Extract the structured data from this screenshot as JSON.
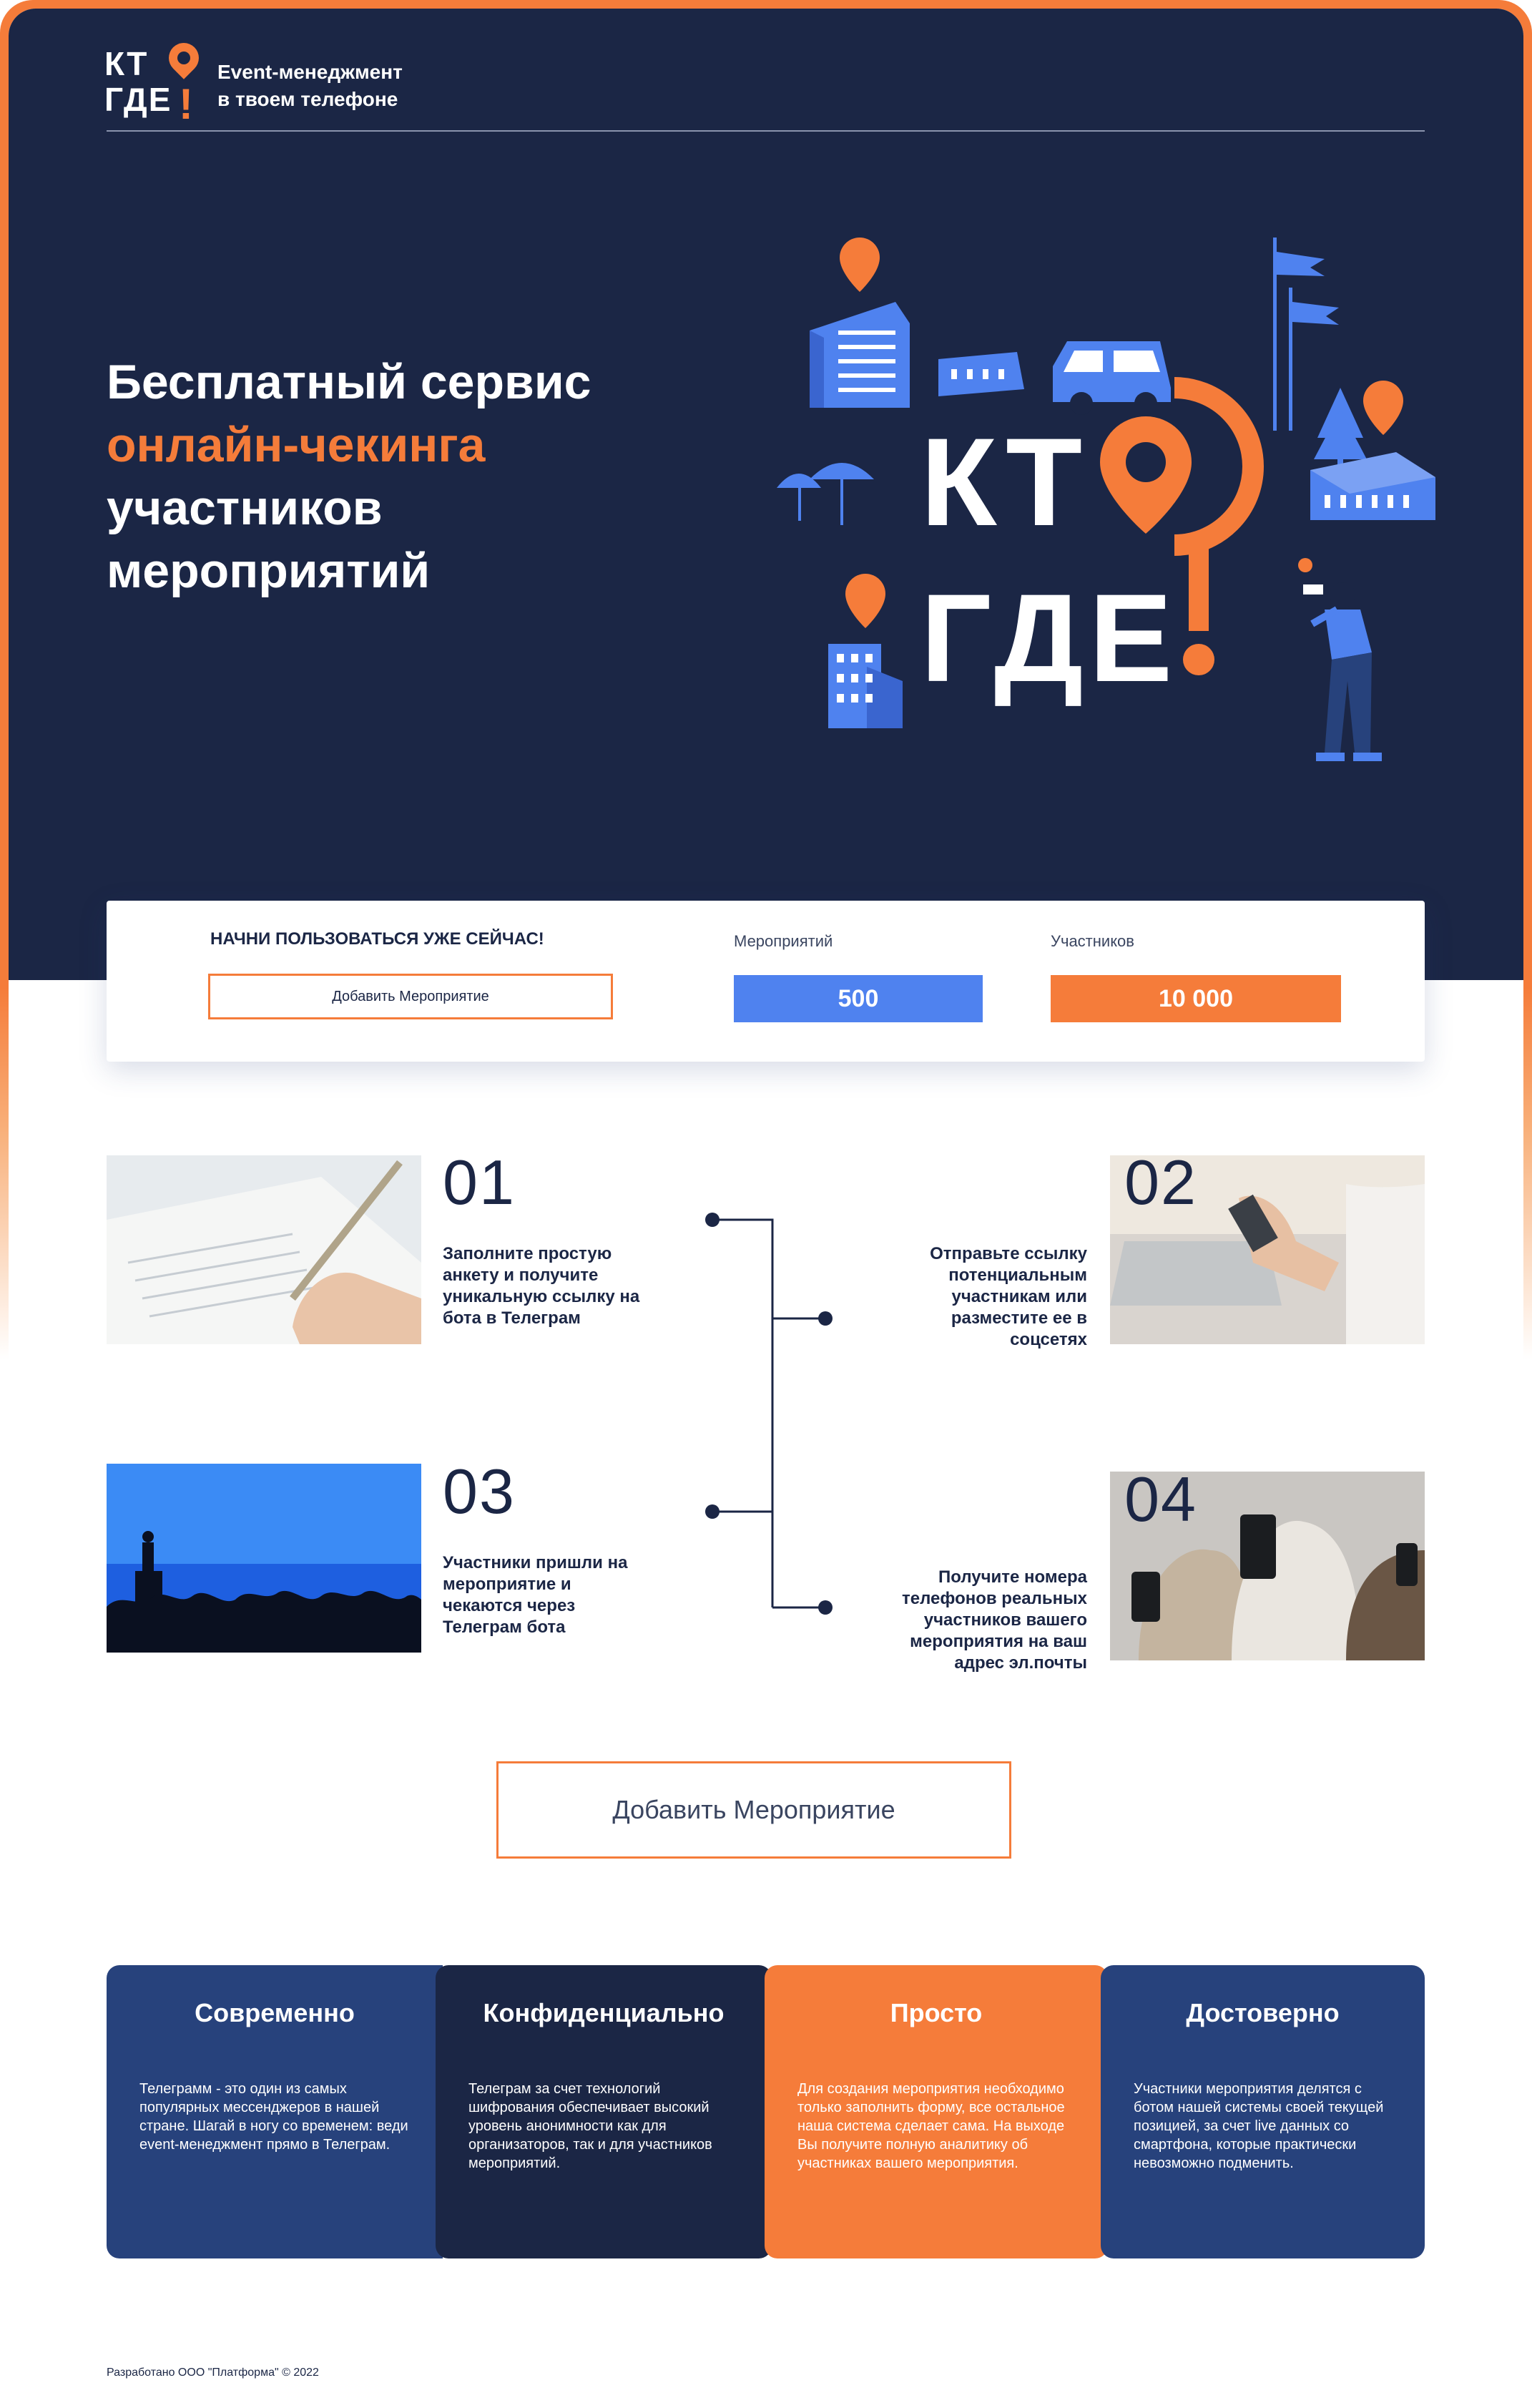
{
  "brand": {
    "logo_top": "КТ",
    "logo_bottom": "ГДЕ",
    "logo_mark": "!",
    "tagline_1": "Event-менеджмент",
    "tagline_2": "в твоем телефоне"
  },
  "hero": {
    "title_1": "Бесплатный сервис",
    "title_accent": "онлайн-чекинга",
    "title_3": "участников",
    "title_4": "мероприятий",
    "illustration_text_1": "КТ",
    "illustration_text_2": "ГДЕ"
  },
  "cta_card": {
    "heading": "НАЧНИ ПОЛЬЗОВАТЬСЯ УЖЕ СЕЙЧАС!",
    "button_label": "Добавить Мероприятие",
    "events_label": "Мероприятий",
    "events_value": "500",
    "participants_label": "Участников",
    "participants_value": "10 000"
  },
  "steps": [
    {
      "number": "01",
      "text": "Заполните простую анкету и получите уникальную ссылку на бота в Телеграм",
      "image": "hand-writing-form"
    },
    {
      "number": "02",
      "text": "Отправьте ссылку потенциальным участникам или разместите ее в соцсетях",
      "image": "phone-and-laptop"
    },
    {
      "number": "03",
      "text": "Участники пришли на мероприятие и чекаются через Телеграм бота",
      "image": "conference-audience"
    },
    {
      "number": "04",
      "text": "Получите номера телефонов реальных участников вашего мероприятия на ваш адрес эл.почты",
      "image": "people-with-phones"
    }
  ],
  "main_button_label": "Добавить Мероприятие",
  "features": [
    {
      "title": "Современно",
      "text": "Телеграмм - это один из самых популярных мессенджеров в нашей стране. Шагай в ногу со временем: веди event-менеджмент прямо в Телеграм.",
      "color": "#27427c"
    },
    {
      "title": "Конфиденциально",
      "text": "Телеграм за счет технологий шифрования обеспечивает высокий уровень анонимности как для организаторов, так и для участников мероприятий.",
      "color": "#1b2645"
    },
    {
      "title": "Просто",
      "text": "Для создания мероприятия необходимо только заполнить форму, все остальное наша система сделает сама. На выходе Вы получите полную аналитику об участниках вашего мероприятия.",
      "color": "#f57c3a"
    },
    {
      "title": "Достоверно",
      "text": "Участники мероприятия делятся с ботом нашей системы своей текущей позицией, за счет live данных со смартфона, которые практически невозможно подменить.",
      "color": "#27427c"
    }
  ],
  "footer": {
    "text": "Разработано ООО \"Платформа\" © 2022"
  },
  "colors": {
    "navy": "#1b2645",
    "orange": "#f57c3a",
    "blue": "#4f82ef",
    "feature_blue": "#27427c"
  }
}
